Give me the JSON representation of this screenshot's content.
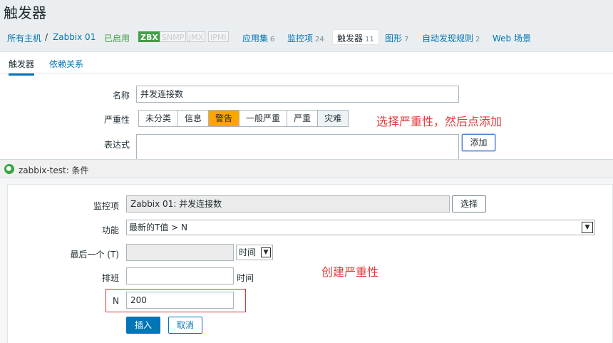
{
  "page": {
    "title": "触发器"
  },
  "nav": {
    "all_hosts": "所有主机",
    "separator": "/",
    "host": "Zabbix 01",
    "status": "已启用",
    "availability": [
      "ZBX",
      "SNMP",
      "JMX",
      "IPMI"
    ],
    "items": [
      {
        "label": "应用集",
        "count": "6"
      },
      {
        "label": "监控项",
        "count": "24"
      },
      {
        "label": "触发器",
        "count": "11"
      },
      {
        "label": "图形",
        "count": "7"
      },
      {
        "label": "自动发现规则",
        "count": "2"
      },
      {
        "label": "Web 场景",
        "count": ""
      }
    ]
  },
  "tabs": {
    "trigger": "触发器",
    "dependencies": "依赖关系"
  },
  "form": {
    "name_label": "名称",
    "name_value": "并发连接数",
    "severity_label": "严重性",
    "severity_options": [
      "未分类",
      "信息",
      "警告",
      "一般严重",
      "严重",
      "灾难"
    ],
    "severity_selected": "警告",
    "expression_label": "表达式",
    "add_button": "添加",
    "annotation": "选择严重性，然后点添加"
  },
  "dialog": {
    "title": "zabbix-test: 条件",
    "item_label": "监控项",
    "item_value": "Zabbix 01: 并发连接数",
    "select_button": "选择",
    "function_label": "功能",
    "function_value": "最新的T值 > N",
    "last_label": "最后一个 (T)",
    "last_value": "",
    "last_unit": "时间",
    "shift_label": "排班",
    "shift_value": "",
    "shift_unit": "时间",
    "n_label": "N",
    "n_value": "200",
    "insert_button": "插入",
    "cancel_button": "取消",
    "annotation": "创建严重性"
  },
  "colors": {
    "link": "#0275b8",
    "enabled": "#429e47",
    "warning": "#ffa500",
    "annotation": "#e03c3c"
  }
}
